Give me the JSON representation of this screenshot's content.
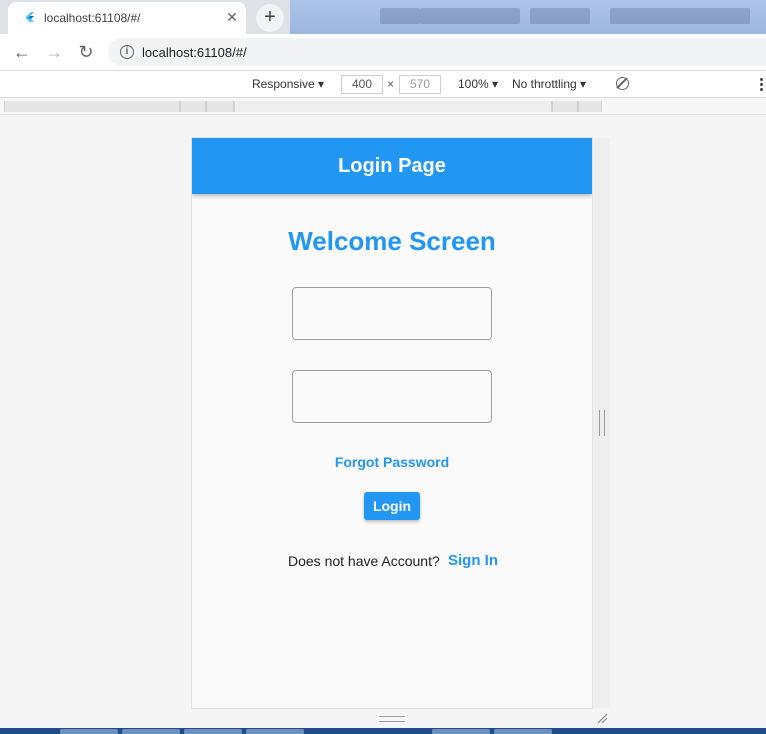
{
  "browser": {
    "tab": {
      "title": "localhost:61108/#/",
      "close_glyph": "✕"
    },
    "new_tab_glyph": "+",
    "nav": {
      "back": "←",
      "forward": "→",
      "reload": "↻"
    },
    "address": {
      "info_glyph": "i",
      "url": "localhost:61108/#/"
    }
  },
  "devtools": {
    "device_mode": "Responsive",
    "width": "400",
    "height": "570",
    "times": "×",
    "zoom": "100%",
    "throttling": "No throttling"
  },
  "app": {
    "appbar_title": "Login Page",
    "appbar_color": "#2196f3",
    "welcome_title": "Welcome Screen",
    "username_field": {
      "value": "",
      "placeholder": ""
    },
    "password_field": {
      "value": "",
      "placeholder": ""
    },
    "forgot_password": "Forgot Password",
    "login_button": "Login",
    "no_account_text": "Does not have Account?",
    "sign_in_link": "Sign In"
  }
}
